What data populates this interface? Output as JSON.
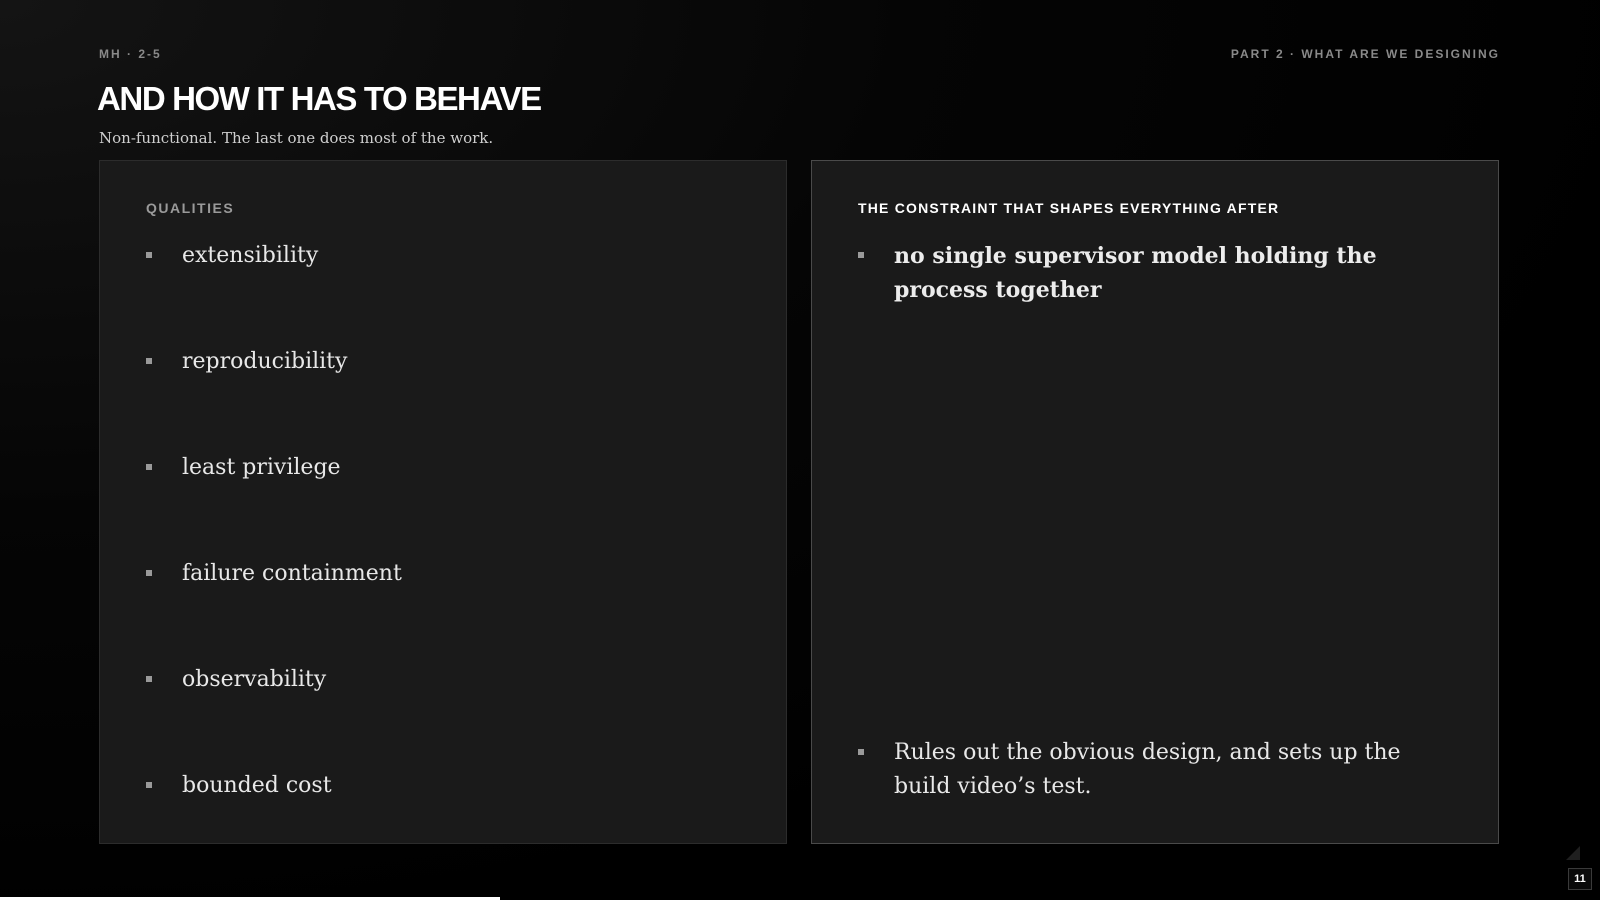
{
  "header": {
    "kicker_left": "MH · 2-5",
    "kicker_right": "PART 2 · WHAT ARE WE DESIGNING",
    "title": "AND HOW IT HAS TO BEHAVE",
    "subtitle": "Non-functional. The last one does most of the work."
  },
  "left_panel": {
    "label": "QUALITIES",
    "items": [
      "extensibility",
      "reproducibility",
      "least privilege",
      "failure containment",
      "observability",
      "bounded cost"
    ]
  },
  "right_panel": {
    "label": "THE CONSTRAINT THAT SHAPES EVERYTHING AFTER",
    "items": [
      "no single supervisor model holding the process together",
      "Rules out the obvious design, and sets up the build video’s test."
    ]
  },
  "footer": {
    "page_number": "11",
    "progress_fraction": 0.3125
  },
  "colors": {
    "background": "#000000",
    "panel": "#1a1a1a",
    "accent_text": "#ffffff",
    "muted_text": "#9a9a9a"
  }
}
